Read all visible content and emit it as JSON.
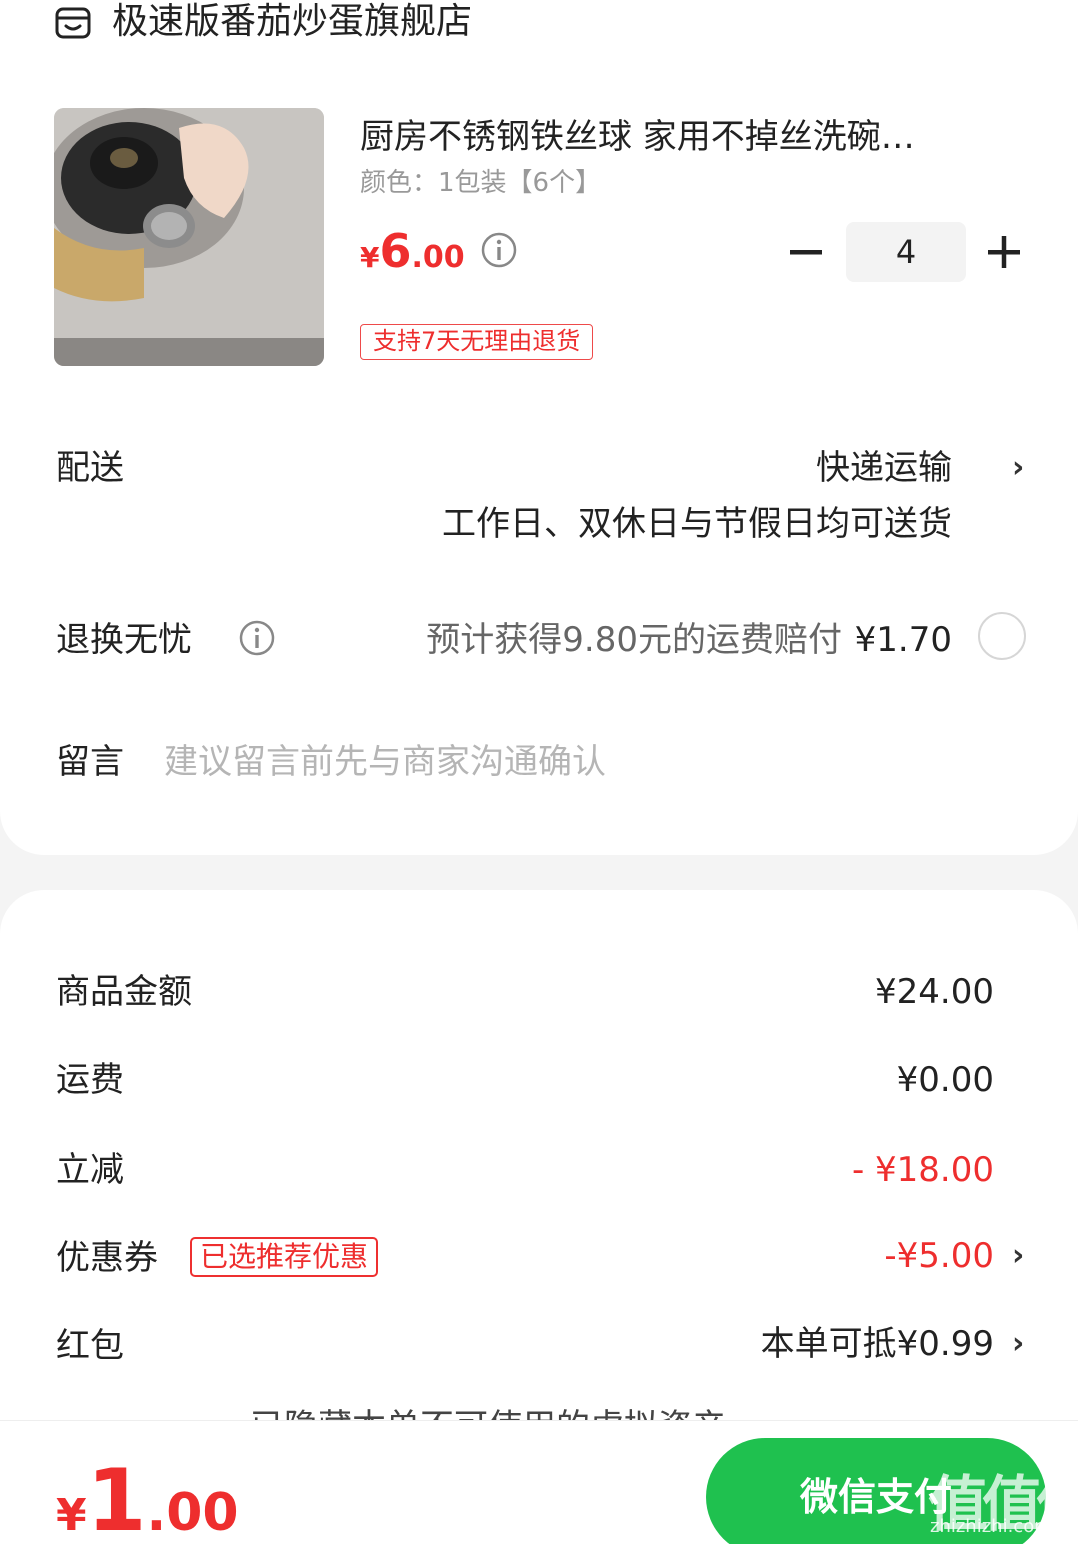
{
  "store": {
    "name": "极速版番茄炒蛋旗舰店",
    "icon": "store-icon"
  },
  "product": {
    "title": "厨房不锈钢铁丝球 家用不掉丝洗碗…",
    "spec": "颜色：1包装【6个】",
    "price_currency": "¥",
    "price_int": "6",
    "price_dec": ".00",
    "quantity": "4",
    "return_tag": "支持7天无理由退货"
  },
  "delivery": {
    "label": "配送",
    "method": "快递运输",
    "note": "工作日、双休日与节假日均可送货"
  },
  "return_worry_free": {
    "label": "退换无忧",
    "desc": "预计获得9.80元的运费赔付",
    "price": "¥1.70"
  },
  "message": {
    "label": "留言",
    "placeholder": "建议留言前先与商家沟通确认"
  },
  "summary": {
    "goods_label": "商品金额",
    "goods_value": "¥24.00",
    "shipping_label": "运费",
    "shipping_value": "¥0.00",
    "discount_label": "立减",
    "discount_value": "- ¥18.00",
    "coupon_label": "优惠券",
    "coupon_tag": "已选推荐优惠",
    "coupon_value": "-¥5.00",
    "redpacket_label": "红包",
    "redpacket_value": "本单可抵¥0.99",
    "hidden_assets_text": "已隐藏本单不可使用的虚拟资产"
  },
  "bottom": {
    "total_currency": "¥",
    "total_int": "1",
    "total_dec": ".00",
    "pay_label": "微信支付"
  },
  "watermark": {
    "text": "值值值",
    "url": "zhizhizhi.com"
  },
  "colors": {
    "accent_red": "#ee2e2e",
    "pay_green": "#1fc14f"
  }
}
